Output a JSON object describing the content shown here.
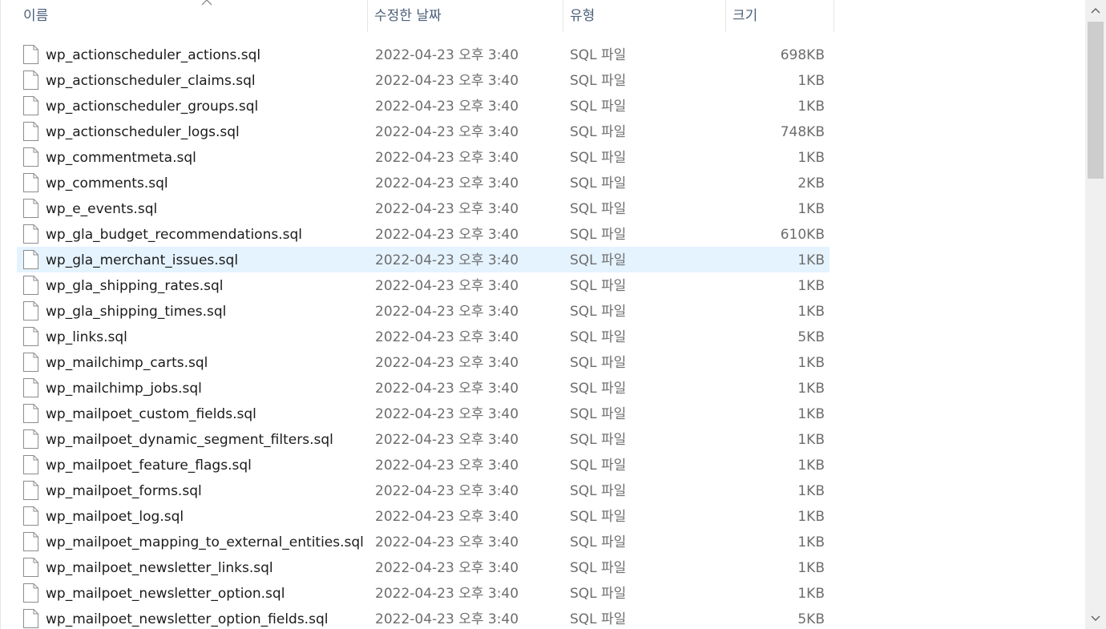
{
  "columns": {
    "name": "이름",
    "date": "수정한 날짜",
    "type": "유형",
    "size": "크기"
  },
  "sort": {
    "column": "name",
    "direction": "ascending",
    "icon": "sort-up-chevron-icon"
  },
  "files": [
    {
      "name": "wp_actionscheduler_actions.sql",
      "date": "2022-04-23 오후 3:40",
      "type": "SQL 파일",
      "size": "698KB"
    },
    {
      "name": "wp_actionscheduler_claims.sql",
      "date": "2022-04-23 오후 3:40",
      "type": "SQL 파일",
      "size": "1KB"
    },
    {
      "name": "wp_actionscheduler_groups.sql",
      "date": "2022-04-23 오후 3:40",
      "type": "SQL 파일",
      "size": "1KB"
    },
    {
      "name": "wp_actionscheduler_logs.sql",
      "date": "2022-04-23 오후 3:40",
      "type": "SQL 파일",
      "size": "748KB"
    },
    {
      "name": "wp_commentmeta.sql",
      "date": "2022-04-23 오후 3:40",
      "type": "SQL 파일",
      "size": "1KB"
    },
    {
      "name": "wp_comments.sql",
      "date": "2022-04-23 오후 3:40",
      "type": "SQL 파일",
      "size": "2KB"
    },
    {
      "name": "wp_e_events.sql",
      "date": "2022-04-23 오후 3:40",
      "type": "SQL 파일",
      "size": "1KB"
    },
    {
      "name": "wp_gla_budget_recommendations.sql",
      "date": "2022-04-23 오후 3:40",
      "type": "SQL 파일",
      "size": "610KB"
    },
    {
      "name": "wp_gla_merchant_issues.sql",
      "date": "2022-04-23 오후 3:40",
      "type": "SQL 파일",
      "size": "1KB",
      "selected": true
    },
    {
      "name": "wp_gla_shipping_rates.sql",
      "date": "2022-04-23 오후 3:40",
      "type": "SQL 파일",
      "size": "1KB"
    },
    {
      "name": "wp_gla_shipping_times.sql",
      "date": "2022-04-23 오후 3:40",
      "type": "SQL 파일",
      "size": "1KB"
    },
    {
      "name": "wp_links.sql",
      "date": "2022-04-23 오후 3:40",
      "type": "SQL 파일",
      "size": "5KB"
    },
    {
      "name": "wp_mailchimp_carts.sql",
      "date": "2022-04-23 오후 3:40",
      "type": "SQL 파일",
      "size": "1KB"
    },
    {
      "name": "wp_mailchimp_jobs.sql",
      "date": "2022-04-23 오후 3:40",
      "type": "SQL 파일",
      "size": "1KB"
    },
    {
      "name": "wp_mailpoet_custom_fields.sql",
      "date": "2022-04-23 오후 3:40",
      "type": "SQL 파일",
      "size": "1KB"
    },
    {
      "name": "wp_mailpoet_dynamic_segment_filters.sql",
      "date": "2022-04-23 오후 3:40",
      "type": "SQL 파일",
      "size": "1KB"
    },
    {
      "name": "wp_mailpoet_feature_flags.sql",
      "date": "2022-04-23 오후 3:40",
      "type": "SQL 파일",
      "size": "1KB"
    },
    {
      "name": "wp_mailpoet_forms.sql",
      "date": "2022-04-23 오후 3:40",
      "type": "SQL 파일",
      "size": "1KB"
    },
    {
      "name": "wp_mailpoet_log.sql",
      "date": "2022-04-23 오후 3:40",
      "type": "SQL 파일",
      "size": "1KB"
    },
    {
      "name": "wp_mailpoet_mapping_to_external_entities.sql",
      "date": "2022-04-23 오후 3:40",
      "type": "SQL 파일",
      "size": "1KB"
    },
    {
      "name": "wp_mailpoet_newsletter_links.sql",
      "date": "2022-04-23 오후 3:40",
      "type": "SQL 파일",
      "size": "1KB"
    },
    {
      "name": "wp_mailpoet_newsletter_option.sql",
      "date": "2022-04-23 오후 3:40",
      "type": "SQL 파일",
      "size": "1KB"
    },
    {
      "name": "wp_mailpoet_newsletter_option_fields.sql",
      "date": "2022-04-23 오후 3:40",
      "type": "SQL 파일",
      "size": "5KB"
    }
  ],
  "colors": {
    "header_text": "#4c607a",
    "name_text": "#1b1b1b",
    "meta_text": "#6d6d6d",
    "selection": "#e5f3ff",
    "scrollbar_track": "#f0f0f0",
    "scrollbar_thumb": "#cdcdcd"
  },
  "icons": {
    "file": "file-icon",
    "scroll_up": "chevron-up-icon",
    "scroll_down": "chevron-down-icon"
  }
}
